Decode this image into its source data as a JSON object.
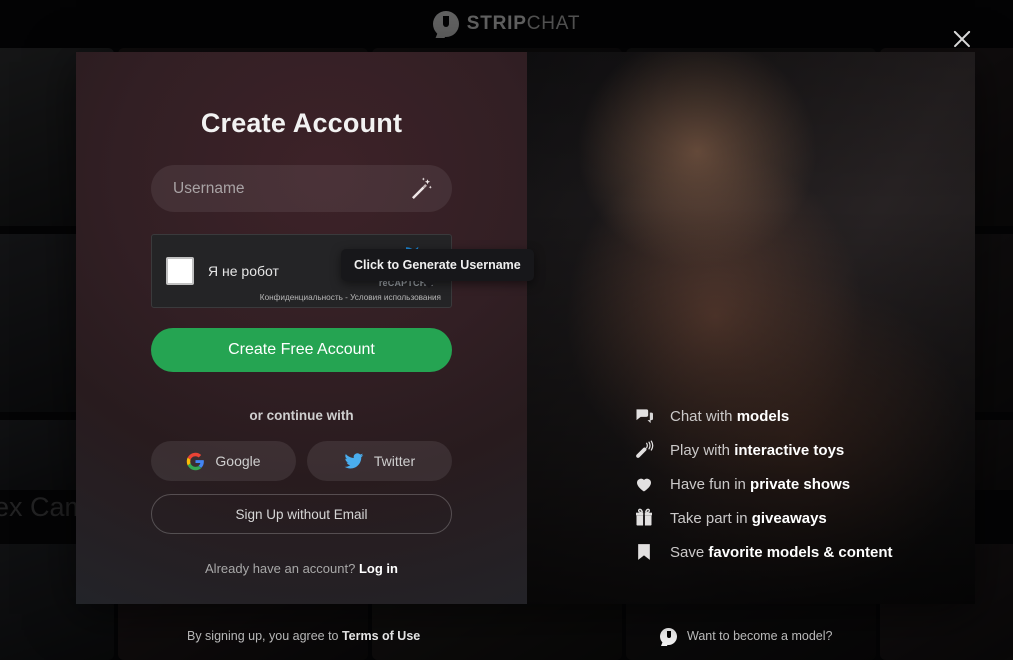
{
  "header": {
    "logo_primary": "STRIP",
    "logo_secondary": "CHAT",
    "logo_icon": "stripchat-bubble-icon",
    "close_icon": "close-icon"
  },
  "background": {
    "heading_top": "ex Cams",
    "heading_lower": "ex Cams"
  },
  "modal": {
    "title": "Create Account",
    "username": {
      "placeholder": "Username",
      "value": "",
      "generate_icon": "magic-wand-icon",
      "tooltip": "Click to Generate Username"
    },
    "recaptcha": {
      "label": "Я не робот",
      "brand": "reCAPTCHA",
      "terms": "Конфиденциальность - Условия использования",
      "checkbox_icon": "checkbox-icon",
      "logo_icon": "recaptcha-logo-icon"
    },
    "primary_button": "Create Free Account",
    "continue_label": "or continue with",
    "social": [
      {
        "label": "Google",
        "icon": "google-icon"
      },
      {
        "label": "Twitter",
        "icon": "twitter-icon"
      }
    ],
    "ghost_button": "Sign Up without Email",
    "login_prompt": "Already have an account?",
    "login_link": "Log in",
    "accent_green": "#25a452"
  },
  "features": [
    {
      "icon": "chat-bubbles-icon",
      "lead": "Chat with ",
      "strong": "models"
    },
    {
      "icon": "interactive-toy-icon",
      "lead": "Play with ",
      "strong": "interactive toys"
    },
    {
      "icon": "heart-icon",
      "lead": "Have fun in ",
      "strong": "private shows"
    },
    {
      "icon": "gift-icon",
      "lead": "Take part in ",
      "strong": "giveaways"
    },
    {
      "icon": "bookmark-icon",
      "lead": "Save ",
      "strong": "favorite models & content"
    }
  ],
  "bottom_bar": {
    "terms_lead": "By signing up, you agree to ",
    "terms_link": "Terms of Use",
    "model_label": "Want to become a model?",
    "model_icon": "stripchat-bubble-icon"
  }
}
